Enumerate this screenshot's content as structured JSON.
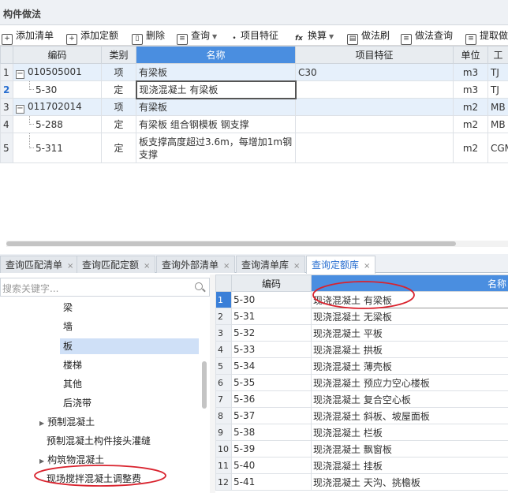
{
  "panel_title": "构件做法",
  "toolbar": [
    {
      "label": "添加清单",
      "icon": "add-list-icon",
      "caret": false
    },
    {
      "label": "添加定额",
      "icon": "add-quota-icon",
      "caret": false
    },
    {
      "label": "删除",
      "icon": "trash-icon",
      "caret": false
    },
    {
      "label": "查询",
      "icon": "query-icon",
      "caret": true
    },
    {
      "label": "项目特征",
      "icon": "feature-icon",
      "caret": true
    },
    {
      "label": "换算",
      "icon": "fx-icon",
      "caret": true
    },
    {
      "label": "做法刷",
      "icon": "brush-icon",
      "caret": false
    },
    {
      "label": "做法查询",
      "icon": "method-query-icon",
      "caret": false
    },
    {
      "label": "提取做",
      "icon": "extract-icon",
      "caret": false
    }
  ],
  "main_table": {
    "headers": [
      "编码",
      "类别",
      "名称",
      "项目特征",
      "单位",
      "工"
    ],
    "rows": [
      {
        "no": "1",
        "code": "010505001",
        "type": "项",
        "name": "有梁板",
        "feature": "C30",
        "unit": "m3",
        "extra": "TJ",
        "toggle": "−"
      },
      {
        "no": "2",
        "code": "5-30",
        "type": "定",
        "name": "现浇混凝土 有梁板",
        "feature": "",
        "unit": "m3",
        "extra": "TJ",
        "toggle": ""
      },
      {
        "no": "3",
        "code": "011702014",
        "type": "项",
        "name": "有梁板",
        "feature": "",
        "unit": "m2",
        "extra": "MB",
        "toggle": "−"
      },
      {
        "no": "4",
        "code": "5-288",
        "type": "定",
        "name": "有梁板 组合钢模板 钢支撑",
        "feature": "",
        "unit": "m2",
        "extra": "MB",
        "toggle": ""
      },
      {
        "no": "5",
        "code": "5-311",
        "type": "定",
        "name": "板支撑高度超过3.6m，每增加1m钢支撑",
        "feature": "",
        "unit": "m2",
        "extra": "CGM",
        "toggle": ""
      }
    ]
  },
  "bottom_tabs": [
    {
      "label": "查询匹配清单"
    },
    {
      "label": "查询匹配定额"
    },
    {
      "label": "查询外部清单"
    },
    {
      "label": "查询清单库"
    },
    {
      "label": "查询定额库"
    }
  ],
  "close_glyph": "×",
  "search": {
    "placeholder": "搜索关键字..."
  },
  "tree": [
    {
      "label": "梁",
      "arrow": ""
    },
    {
      "label": "墙",
      "arrow": ""
    },
    {
      "label": "板",
      "arrow": ""
    },
    {
      "label": "楼梯",
      "arrow": ""
    },
    {
      "label": "其他",
      "arrow": ""
    },
    {
      "label": "后浇带",
      "arrow": ""
    },
    {
      "label": "预制混凝土",
      "arrow": "▶"
    },
    {
      "label": "预制混凝土构件接头灌缝",
      "arrow": ""
    },
    {
      "label": "构筑物混凝土",
      "arrow": "▶"
    },
    {
      "label": "现场搅拌混凝土调整费",
      "arrow": ""
    }
  ],
  "quota_table": {
    "headers": [
      "编码",
      "名称"
    ],
    "rows": [
      {
        "no": "1",
        "code": "5-30",
        "name": "现浇混凝土 有梁板"
      },
      {
        "no": "2",
        "code": "5-31",
        "name": "现浇混凝土 无梁板"
      },
      {
        "no": "3",
        "code": "5-32",
        "name": "现浇混凝土 平板"
      },
      {
        "no": "4",
        "code": "5-33",
        "name": "现浇混凝土 拱板"
      },
      {
        "no": "5",
        "code": "5-34",
        "name": "现浇混凝土 薄壳板"
      },
      {
        "no": "6",
        "code": "5-35",
        "name": "现浇混凝土 预应力空心楼板"
      },
      {
        "no": "7",
        "code": "5-36",
        "name": "现浇混凝土 复合空心板"
      },
      {
        "no": "8",
        "code": "5-37",
        "name": "现浇混凝土 斜板、坡屋面板"
      },
      {
        "no": "9",
        "code": "5-38",
        "name": "现浇混凝土 栏板"
      },
      {
        "no": "10",
        "code": "5-39",
        "name": "现浇混凝土 飘窗板"
      },
      {
        "no": "11",
        "code": "5-40",
        "name": "现浇混凝土 挂板"
      },
      {
        "no": "12",
        "code": "5-41",
        "name": "现浇混凝土 天沟、挑檐板"
      }
    ]
  },
  "colors": {
    "accent": "#4a8ee0",
    "annotation": "#d9232e",
    "selected_row": "#e6f0fb"
  }
}
